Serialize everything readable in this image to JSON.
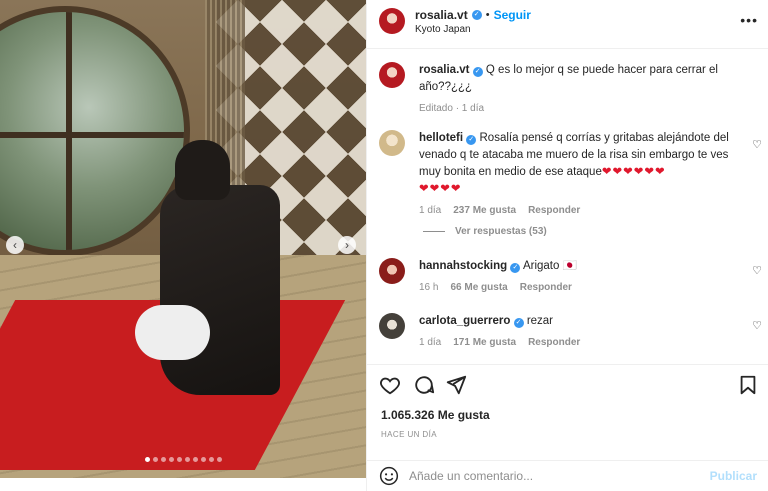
{
  "post": {
    "author": "rosalia.vt",
    "follow_label": "Seguir",
    "location": "Kyoto Japan",
    "more_icon": "more-options-icon",
    "carousel": {
      "total_slides": 10,
      "active_slide": 1
    }
  },
  "caption": {
    "username": "rosalia.vt",
    "text": "Q es lo mejor q se puede hacer para cerrar el año??¿¿¿",
    "edited": "Editado · 1 día"
  },
  "comments": [
    {
      "username": "hellotefi",
      "text": "Rosalía pensé q corrías y gritabas alejándote del venado q te atacaba me muero de la risa sin embargo te ves muy bonita en medio de ese ataque",
      "hearts_tail": "❤❤❤❤❤❤",
      "hearts_line": "❤❤❤❤",
      "time": "1 día",
      "likes": "237 Me gusta",
      "reply": "Responder",
      "view_replies": "Ver respuestas (53)"
    },
    {
      "username": "hannahstocking",
      "text": "Arigato 🇯🇵",
      "time": "16 h",
      "likes": "66 Me gusta",
      "reply": "Responder"
    },
    {
      "username": "carlota_guerrero",
      "text": "rezar",
      "time": "1 día",
      "likes": "171 Me gusta",
      "reply": "Responder"
    }
  ],
  "actions": {
    "like_icon": "heart-icon",
    "comment_icon": "comment-icon",
    "share_icon": "share-icon",
    "save_icon": "bookmark-icon"
  },
  "likes_count": "1.065.326 Me gusta",
  "posted": "HACE UN DÍA",
  "add_comment": {
    "placeholder": "Añade un comentario...",
    "publish_label": "Publicar",
    "emoji_icon": "emoji-icon"
  },
  "colors": {
    "accent_blue": "#0095f6",
    "verified_blue": "#3897f0",
    "heart_red": "#e0182d",
    "publish_disabled": "#b2dffc"
  }
}
